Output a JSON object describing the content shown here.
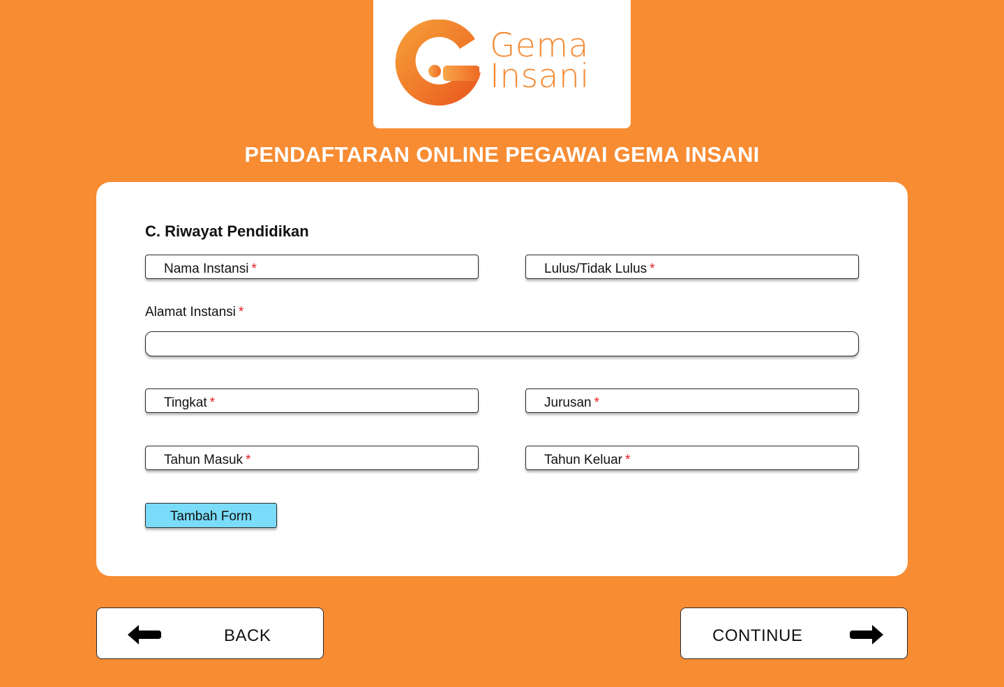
{
  "logo": {
    "line1": "Gema",
    "line2": "Insani",
    "brand_color": "#f38a33",
    "icon": "gema-insani-g-logo-icon"
  },
  "page_title": "PENDAFTARAN ONLINE PEGAWAI GEMA INSANI",
  "section": {
    "title": "C. Riwayat Pendidikan"
  },
  "fields": {
    "nama_instansi": "Nama Instansi",
    "lulus": "Lulus/Tidak Lulus",
    "alamat_instansi": "Alamat Instansi",
    "tingkat": "Tingkat",
    "jurusan": "Jurusan",
    "tahun_masuk": "Tahun Masuk",
    "tahun_keluar": "Tahun Keluar",
    "required_mark": "*"
  },
  "add_form_button": "Tambah Form",
  "navigation": {
    "back": "BACK",
    "continue": "CONTINUE",
    "back_icon": "arrow-left-icon",
    "continue_icon": "arrow-right-icon"
  },
  "colors": {
    "background": "#f78c33",
    "card": "#ffffff",
    "add_button": "#7adcf8",
    "required": "#e11d1d"
  }
}
